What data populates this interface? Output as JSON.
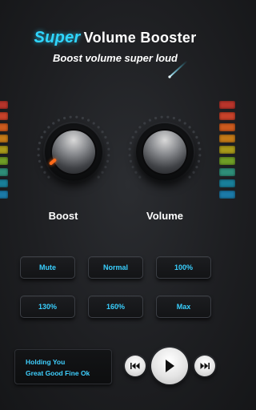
{
  "header": {
    "title_accent": "Super",
    "title_rest": "Volume Booster",
    "subtitle": "Boost volume super loud"
  },
  "meters": {
    "colors": [
      "#b8342b",
      "#c8422a",
      "#cc5a1e",
      "#c47a18",
      "#a8991a",
      "#6f9d26",
      "#2e8e78",
      "#197f9a",
      "#1c7aa8"
    ]
  },
  "knobs": {
    "boost": {
      "label": "Boost",
      "indicator_icon": "orange-indicator-icon"
    },
    "volume": {
      "label": "Volume"
    }
  },
  "presets": [
    {
      "label": "Mute"
    },
    {
      "label": "Normal"
    },
    {
      "label": "100%"
    },
    {
      "label": "130%"
    },
    {
      "label": "160%"
    },
    {
      "label": "Max"
    }
  ],
  "player": {
    "line1": "Holding You",
    "line2": "Great Good Fine Ok",
    "prev_icon": "previous-track-icon",
    "play_icon": "play-icon",
    "next_icon": "next-track-icon"
  },
  "colors": {
    "accent": "#2fd6ff",
    "preset_text": "#39d0ff",
    "indicator": "#ff6a1a"
  }
}
